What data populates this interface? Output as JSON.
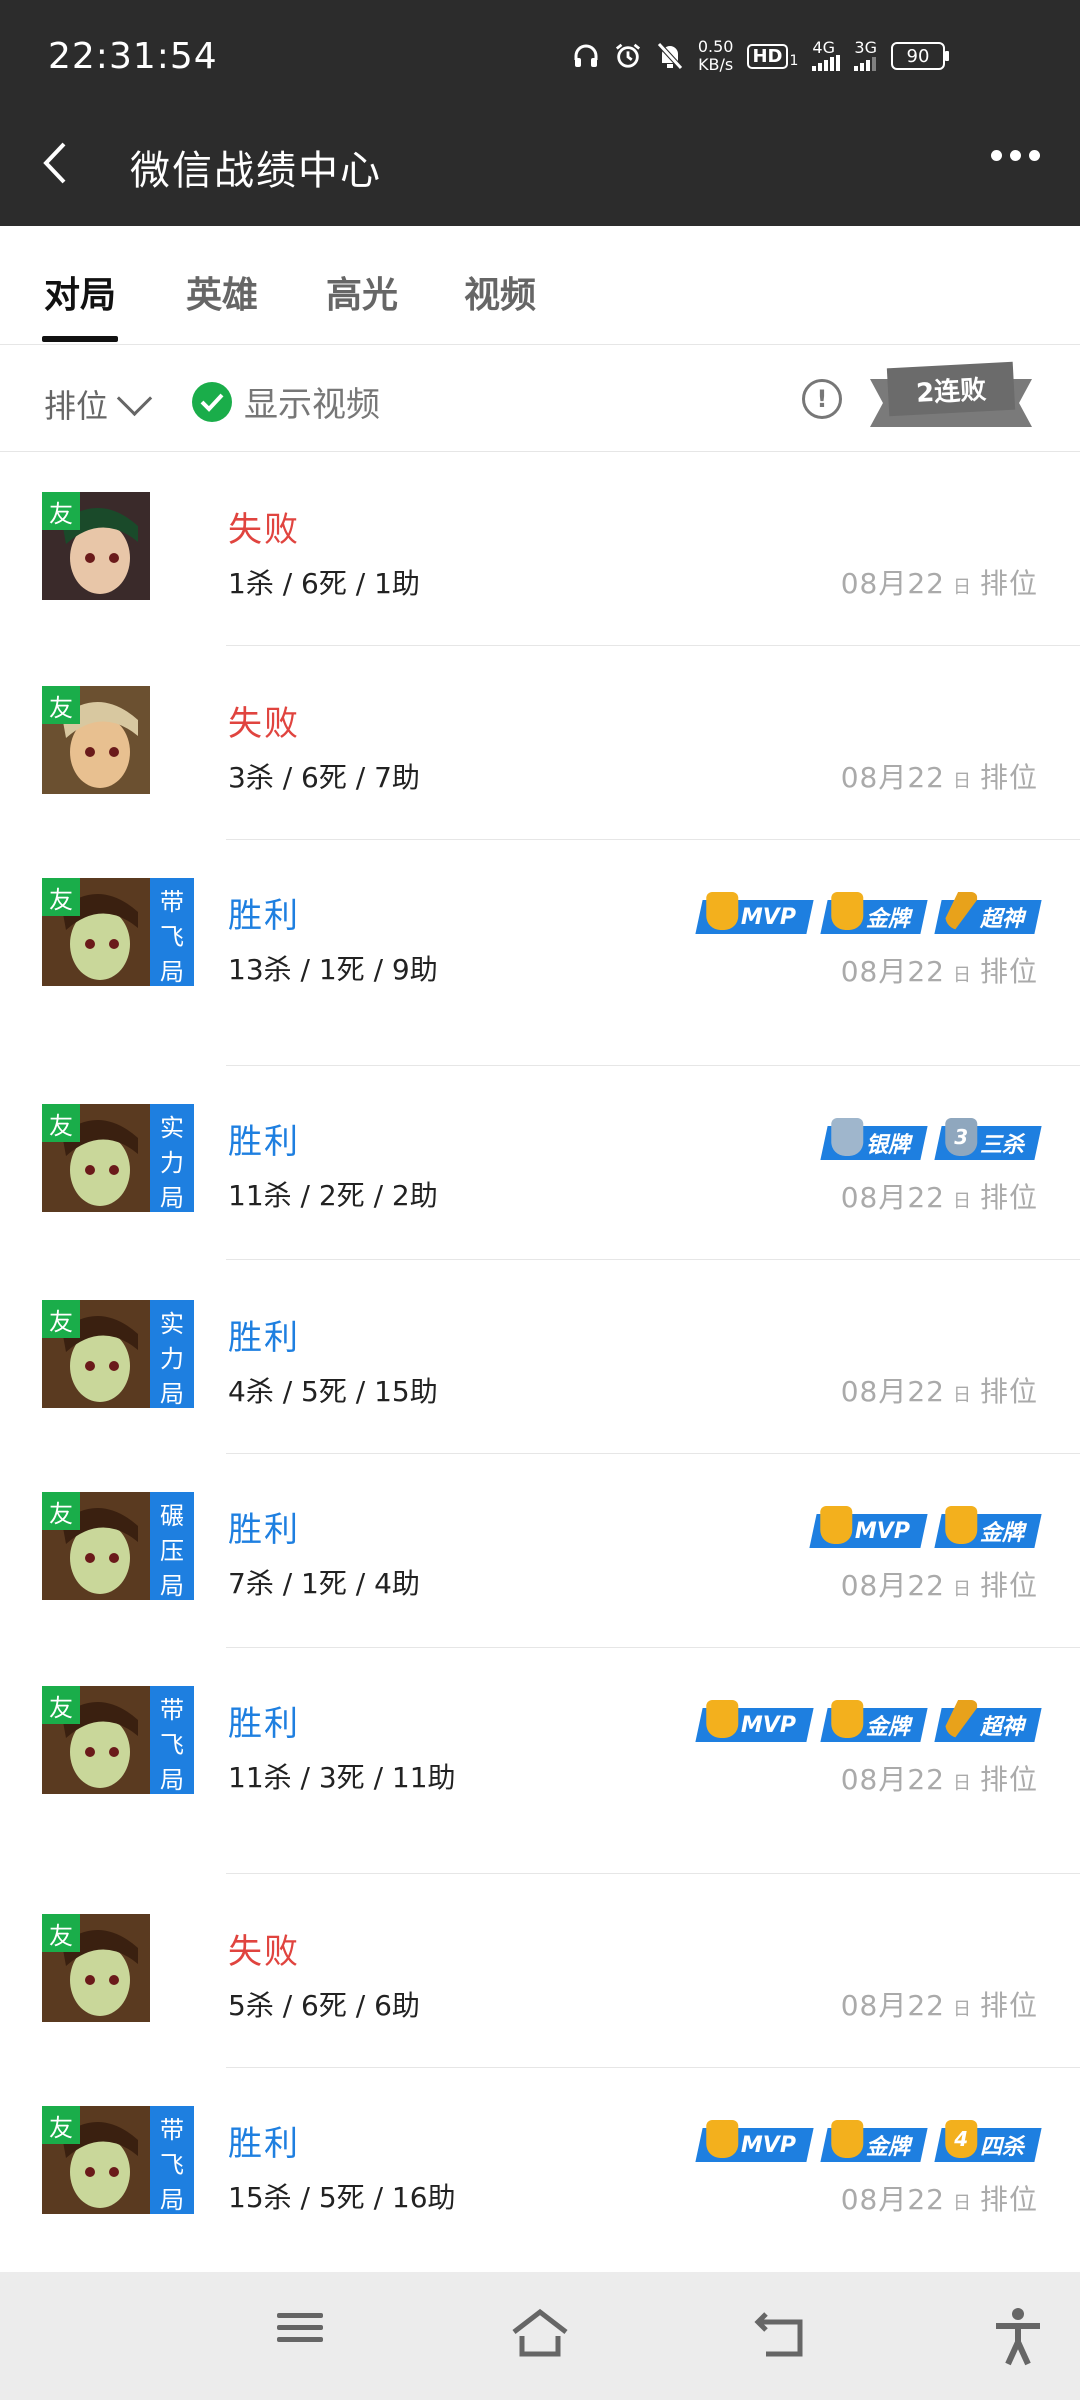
{
  "status_bar": {
    "time": "22:31:54",
    "net_speed_value": "0.50",
    "net_speed_unit": "KB/s",
    "hd": "HD",
    "hd_sub": "1",
    "sig1": "4G",
    "sig2": "3G",
    "battery": "90"
  },
  "header": {
    "title": "微信战绩中心"
  },
  "tabs": [
    {
      "label": "对局",
      "active": true
    },
    {
      "label": "英雄",
      "active": false
    },
    {
      "label": "高光",
      "active": false
    },
    {
      "label": "视频",
      "active": false
    }
  ],
  "filter": {
    "mode": "排位",
    "show_video": "显示视频",
    "streak": "2连败"
  },
  "matches": [
    {
      "result": "失败",
      "outcome": "lose",
      "kda": "1杀 / 6死 / 1助",
      "date": "08月22",
      "day_suffix": "日",
      "mode": "排位",
      "friend": "友",
      "tag": [],
      "honors": []
    },
    {
      "result": "失败",
      "outcome": "lose",
      "kda": "3杀 / 6死 / 7助",
      "date": "08月22",
      "day_suffix": "日",
      "mode": "排位",
      "friend": "友",
      "tag": [],
      "honors": []
    },
    {
      "result": "胜利",
      "outcome": "win",
      "kda": "13杀 / 1死 / 9助",
      "date": "08月22",
      "day_suffix": "日",
      "mode": "排位",
      "friend": "友",
      "tag": [
        "带",
        "飞",
        "局"
      ],
      "honors": [
        {
          "label": "MVP",
          "icon": "trophy"
        },
        {
          "label": "金牌",
          "icon": "gold"
        },
        {
          "label": "超神",
          "icon": "sword"
        }
      ]
    },
    {
      "result": "胜利",
      "outcome": "win",
      "kda": "11杀 / 2死 / 2助",
      "date": "08月22",
      "day_suffix": "日",
      "mode": "排位",
      "friend": "友",
      "tag": [
        "实",
        "力",
        "局"
      ],
      "honors": [
        {
          "label": "银牌",
          "icon": "silver"
        },
        {
          "label": "三杀",
          "icon": "shield3",
          "mark": "3"
        }
      ]
    },
    {
      "result": "胜利",
      "outcome": "win",
      "kda": "4杀 / 5死 / 15助",
      "date": "08月22",
      "day_suffix": "日",
      "mode": "排位",
      "friend": "友",
      "tag": [
        "实",
        "力",
        "局"
      ],
      "honors": []
    },
    {
      "result": "胜利",
      "outcome": "win",
      "kda": "7杀 / 1死 / 4助",
      "date": "08月22",
      "day_suffix": "日",
      "mode": "排位",
      "friend": "友",
      "tag": [
        "碾",
        "压",
        "局"
      ],
      "honors": [
        {
          "label": "MVP",
          "icon": "trophy"
        },
        {
          "label": "金牌",
          "icon": "gold"
        }
      ]
    },
    {
      "result": "胜利",
      "outcome": "win",
      "kda": "11杀 / 3死 / 11助",
      "date": "08月22",
      "day_suffix": "日",
      "mode": "排位",
      "friend": "友",
      "tag": [
        "带",
        "飞",
        "局"
      ],
      "honors": [
        {
          "label": "MVP",
          "icon": "trophy"
        },
        {
          "label": "金牌",
          "icon": "gold"
        },
        {
          "label": "超神",
          "icon": "sword"
        }
      ]
    },
    {
      "result": "失败",
      "outcome": "lose",
      "kda": "5杀 / 6死 / 6助",
      "date": "08月22",
      "day_suffix": "日",
      "mode": "排位",
      "friend": "友",
      "tag": [],
      "honors": []
    },
    {
      "result": "胜利",
      "outcome": "win",
      "kda": "15杀 / 5死 / 16助",
      "date": "08月22",
      "day_suffix": "日",
      "mode": "排位",
      "friend": "友",
      "tag": [
        "带",
        "飞",
        "局"
      ],
      "honors": [
        {
          "label": "MVP",
          "icon": "trophy"
        },
        {
          "label": "金牌",
          "icon": "gold"
        },
        {
          "label": "四杀",
          "icon": "shield4",
          "mark": "4"
        }
      ]
    }
  ]
}
